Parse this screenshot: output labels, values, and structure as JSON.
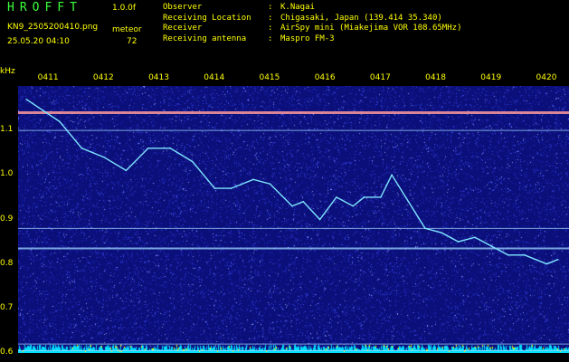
{
  "header": {
    "app_title": "HROFFT",
    "version": "1.0.0f",
    "filename": "KN9_2505200410.png",
    "mode": "meteor",
    "datetime": "25.05.20 04:10",
    "count": "72",
    "info": [
      {
        "key": "Observer",
        "value": "K.Nagai"
      },
      {
        "key": "Receiving Location",
        "value": "Chigasaki, Japan (139.414 35.340)"
      },
      {
        "key": "Receiver",
        "value": "AirSpy mini (Miakejima VOR 108.65MHz)"
      },
      {
        "key": "Receiving antenna",
        "value": "Maspro FM-3"
      }
    ]
  },
  "chart_data": {
    "type": "heatmap",
    "ylabel": "kHz",
    "ylim": [
      0.6,
      1.2
    ],
    "yticks": [
      "1.1",
      "1.0",
      "0.9",
      "0.8",
      "0.7",
      "0.6"
    ],
    "xticks": [
      "0411",
      "0412",
      "0413",
      "0414",
      "0415",
      "0416",
      "0417",
      "0418",
      "0419",
      "0420"
    ],
    "carrier_lines_khz": [
      1.14,
      1.1,
      0.88,
      0.835,
      0.62,
      0.605
    ],
    "trace": [
      {
        "t": "0410.6",
        "f": 1.17
      },
      {
        "t": "0411.2",
        "f": 1.12
      },
      {
        "t": "0411.6",
        "f": 1.06
      },
      {
        "t": "0412.0",
        "f": 1.04
      },
      {
        "t": "0412.4",
        "f": 1.01
      },
      {
        "t": "0412.8",
        "f": 1.06
      },
      {
        "t": "0413.2",
        "f": 1.06
      },
      {
        "t": "0413.6",
        "f": 1.03
      },
      {
        "t": "0414.0",
        "f": 0.97
      },
      {
        "t": "0414.3",
        "f": 0.97
      },
      {
        "t": "0414.7",
        "f": 0.99
      },
      {
        "t": "0415.0",
        "f": 0.98
      },
      {
        "t": "0415.4",
        "f": 0.93
      },
      {
        "t": "0415.6",
        "f": 0.94
      },
      {
        "t": "0415.9",
        "f": 0.9
      },
      {
        "t": "0416.2",
        "f": 0.95
      },
      {
        "t": "0416.5",
        "f": 0.93
      },
      {
        "t": "0416.7",
        "f": 0.95
      },
      {
        "t": "0417.0",
        "f": 0.95
      },
      {
        "t": "0417.2",
        "f": 1.0
      },
      {
        "t": "0417.5",
        "f": 0.94
      },
      {
        "t": "0417.8",
        "f": 0.88
      },
      {
        "t": "0418.1",
        "f": 0.87
      },
      {
        "t": "0418.4",
        "f": 0.85
      },
      {
        "t": "0418.7",
        "f": 0.86
      },
      {
        "t": "0419.0",
        "f": 0.84
      },
      {
        "t": "0419.3",
        "f": 0.82
      },
      {
        "t": "0419.6",
        "f": 0.82
      },
      {
        "t": "0420.0",
        "f": 0.8
      },
      {
        "t": "0420.2",
        "f": 0.81
      }
    ],
    "colors": {
      "background": "#0b0f7a",
      "noise": "#3a48e6",
      "trace": "#7ee6ff",
      "carrier": "#9fd7ff",
      "text": "#ffff00",
      "title": "#3cff3c",
      "meter": "#00e0ff"
    }
  }
}
